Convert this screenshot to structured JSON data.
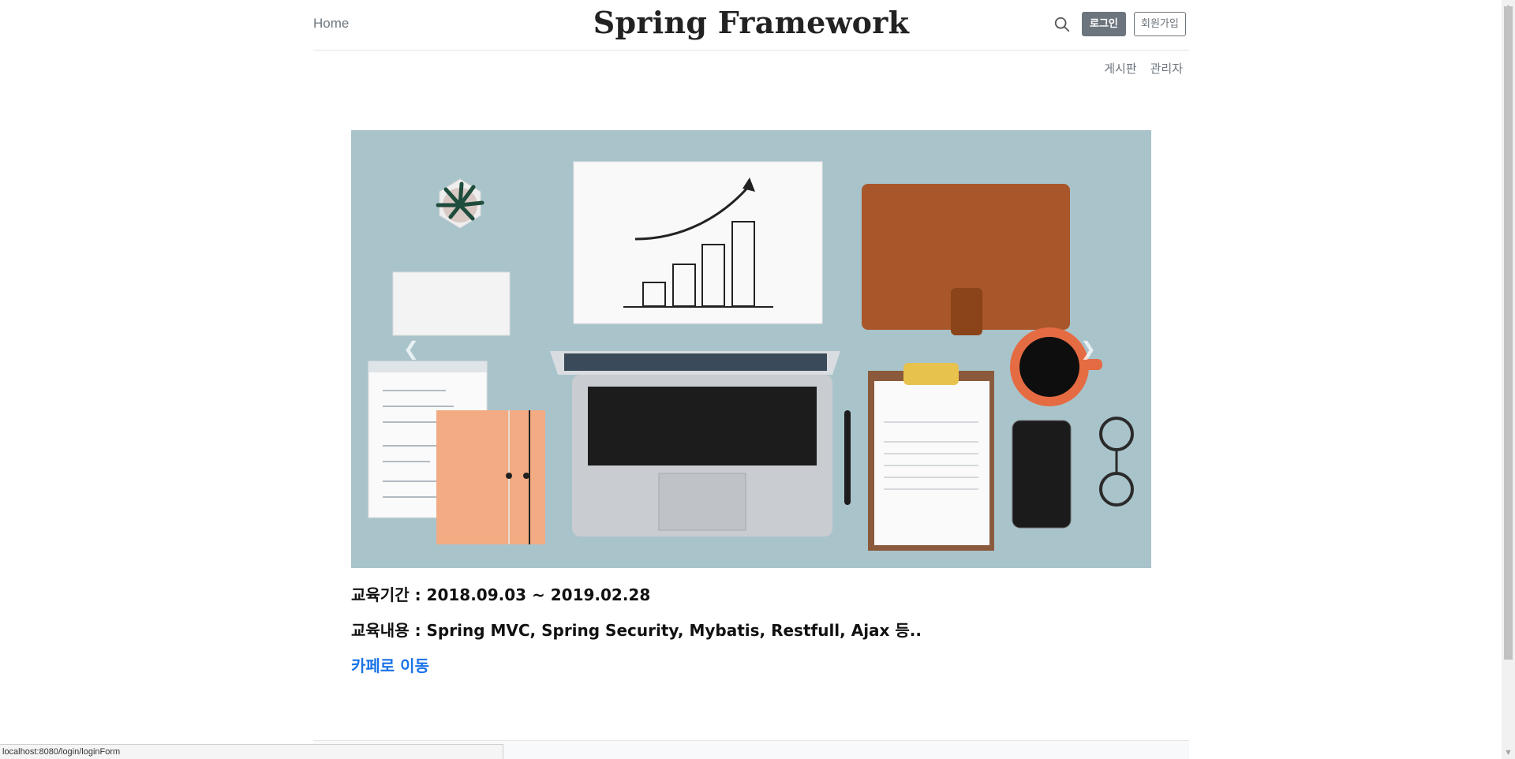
{
  "header": {
    "home_label": "Home",
    "brand": "Spring Framework",
    "login_label": "로그인",
    "signup_label": "회원가입"
  },
  "nav": {
    "items": [
      {
        "label": "게시판"
      },
      {
        "label": "관리자"
      }
    ]
  },
  "carousel": {
    "prev_icon": "chevron-left-icon",
    "next_icon": "chevron-right-icon"
  },
  "main": {
    "period": "교육기간 : 2018.09.03 ~ 2019.02.28",
    "content": "교육내용 : Spring MVC, Spring Security, Mybatis, Restfull, Ajax 등..",
    "cafe_link": "카페로 이동"
  },
  "status_bar": {
    "url": "localhost:8080/login/loginForm"
  },
  "colors": {
    "accent_link": "#1a73e8",
    "secondary": "#6c757d",
    "carousel_bg": "#a9c3cb"
  }
}
